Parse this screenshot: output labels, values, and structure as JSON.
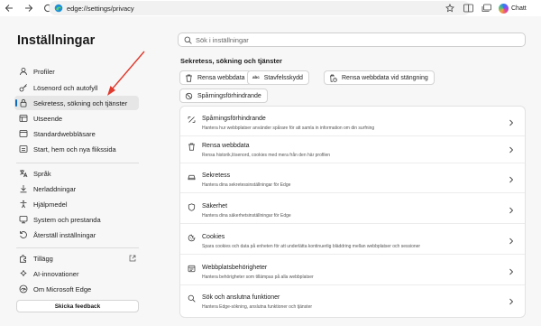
{
  "browser": {
    "url": "edge://settings/privacy",
    "chat_label": "Chatt"
  },
  "sidebar": {
    "title": "Inställningar",
    "items": [
      {
        "label": "Profiler",
        "icon": "profile-icon"
      },
      {
        "label": "Lösenord och autofyll",
        "icon": "key-icon"
      },
      {
        "label": "Sekretess, sökning och tjänster",
        "icon": "lock-icon",
        "active": true
      },
      {
        "label": "Utseende",
        "icon": "appearance-icon"
      },
      {
        "label": "Standardwebbläsare",
        "icon": "browser-icon"
      },
      {
        "label": "Start, hem och nya flikssida",
        "icon": "home-icon"
      },
      {
        "label": "Språk",
        "icon": "language-icon"
      },
      {
        "label": "Nerladdningar",
        "icon": "download-icon"
      },
      {
        "label": "Hjälpmedel",
        "icon": "accessibility-icon"
      },
      {
        "label": "System och prestanda",
        "icon": "system-icon"
      },
      {
        "label": "Återställ inställningar",
        "icon": "reset-icon"
      },
      {
        "label": "Tillägg",
        "icon": "extensions-icon"
      },
      {
        "label": "AI-innovationer",
        "icon": "sparkle-icon"
      },
      {
        "label": "Om Microsoft Edge",
        "icon": "edge-icon"
      }
    ],
    "feedback_label": "Skicka feedback"
  },
  "main": {
    "search_placeholder": "Sök i inställningar",
    "section_title": "Sekretess, sökning och tjänster",
    "chips": [
      {
        "label": "Rensa webbdata",
        "icon": "trash-icon"
      },
      {
        "label": "Stavfelsskydd",
        "icon": "spellcheck-icon",
        "glyph": "abc"
      },
      {
        "label": "Rensa webbdata vid stängning",
        "icon": "trash-clock-icon"
      },
      {
        "label": "Spårningsförhindrande",
        "icon": "tracking-icon"
      }
    ],
    "rows": [
      {
        "title": "Spårningsförhindrande",
        "desc": "Hantera hur webbplatser använder spårare för att samla in information om din surfning",
        "icon": "tracking-icon"
      },
      {
        "title": "Rensa webbdata",
        "desc": "Rensa historik,lösenord, cookies med mera från den här profilen",
        "icon": "trash-icon"
      },
      {
        "title": "Sekretess",
        "desc": "Hantera dina sekretessinställningar för Edge",
        "icon": "privacy-icon"
      },
      {
        "title": "Säkerhet",
        "desc": "Hantera dina säkerhetsinställningar för Edge",
        "icon": "shield-icon"
      },
      {
        "title": "Cookies",
        "desc": "Spara cookies och data på enheten för att underlätta kontinuerlig bläddring mellan webbplatser och sessioner",
        "icon": "cookie-icon"
      },
      {
        "title": "Webbplatsbehörigheter",
        "desc": "Hantera behörigheter som tillämpas på alla webbplatser",
        "icon": "permissions-icon"
      },
      {
        "title": "Sök och anslutna funktioner",
        "desc": "Hantera Edge-sökning, anslutna funktioner och tjänster",
        "icon": "search-icon"
      }
    ]
  },
  "colors": {
    "accent": "#0f6cbd",
    "annotation_arrow": "#e03a2e"
  }
}
